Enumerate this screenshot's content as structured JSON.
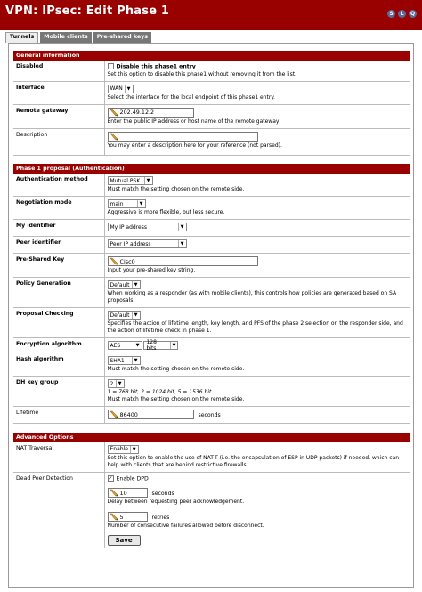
{
  "title": "VPN: IPsec: Edit Phase 1",
  "top_icons": [
    "S",
    "L",
    "Q"
  ],
  "tabs": [
    "Tunnels",
    "Mobile clients",
    "Pre-shared keys"
  ],
  "general": {
    "header": "General information",
    "disabled": {
      "label": "Disabled",
      "checkbox_label": "Disable this phase1 entry",
      "hint": "Set this option to disable this phase1 without removing it from the list."
    },
    "interface": {
      "label": "Interface",
      "value": "WAN",
      "hint": "Select the interface for the local endpoint of this phase1 entry."
    },
    "remote_gateway": {
      "label": "Remote gateway",
      "value": "202.49.12.2",
      "hint": "Enter the public IP address or host name of the remote gateway"
    },
    "description": {
      "label": "Description",
      "value": "",
      "hint": "You may enter a description here for your reference (not parsed)."
    }
  },
  "phase1": {
    "header": "Phase 1 proposal (Authentication)",
    "auth_method": {
      "label": "Authentication method",
      "value": "Mutual PSK",
      "hint": "Must match the setting chosen on the remote side."
    },
    "negotiation": {
      "label": "Negotiation mode",
      "value": "main",
      "hint": "Aggressive is more flexible, but less secure."
    },
    "my_identifier": {
      "label": "My identifier",
      "value": "My IP address"
    },
    "peer_identifier": {
      "label": "Peer identifier",
      "value": "Peer IP address"
    },
    "psk": {
      "label": "Pre-Shared Key",
      "value": "Cisc0",
      "hint": "Input your pre-shared key string."
    },
    "policy_generation": {
      "label": "Policy Generation",
      "value": "Default",
      "hint": "When working as a responder (as with mobile clients), this controls how policies are generated based on SA proposals."
    },
    "proposal_checking": {
      "label": "Proposal Checking",
      "value": "Default",
      "hint": "Specifies the action of lifetime length, key length, and PFS of the phase 2 selection on the responder side, and the action of lifetime check in phase 1."
    },
    "encryption": {
      "label": "Encryption algorithm",
      "value": "AES",
      "bits": "128 bits"
    },
    "hash": {
      "label": "Hash algorithm",
      "value": "SHA1",
      "hint": "Must match the setting chosen on the remote side."
    },
    "dh_group": {
      "label": "DH key group",
      "value": "2",
      "legend": "1 = 768 bit, 2 = 1024 bit, 5 = 1536 bit",
      "hint": "Must match the setting chosen on the remote side."
    },
    "lifetime": {
      "label": "Lifetime",
      "value": "86400",
      "unit": "seconds"
    }
  },
  "advanced": {
    "header": "Advanced Options",
    "nat_traversal": {
      "label": "NAT Traversal",
      "value": "Enable",
      "hint": "Set this option to enable the use of NAT-T (i.e. the encapsulation of ESP in UDP packets) if needed, which can help with clients that are behind restrictive firewalls."
    },
    "dpd": {
      "label": "Dead Peer Detection",
      "checkbox_label": "Enable DPD",
      "checked": true,
      "delay_value": "10",
      "delay_unit": "seconds",
      "delay_hint": "Delay between requesting peer acknowledgement.",
      "retries_value": "5",
      "retries_unit": "retries",
      "retries_hint": "Number of consecutive failures allowed before disconnect."
    }
  },
  "save_label": "Save"
}
